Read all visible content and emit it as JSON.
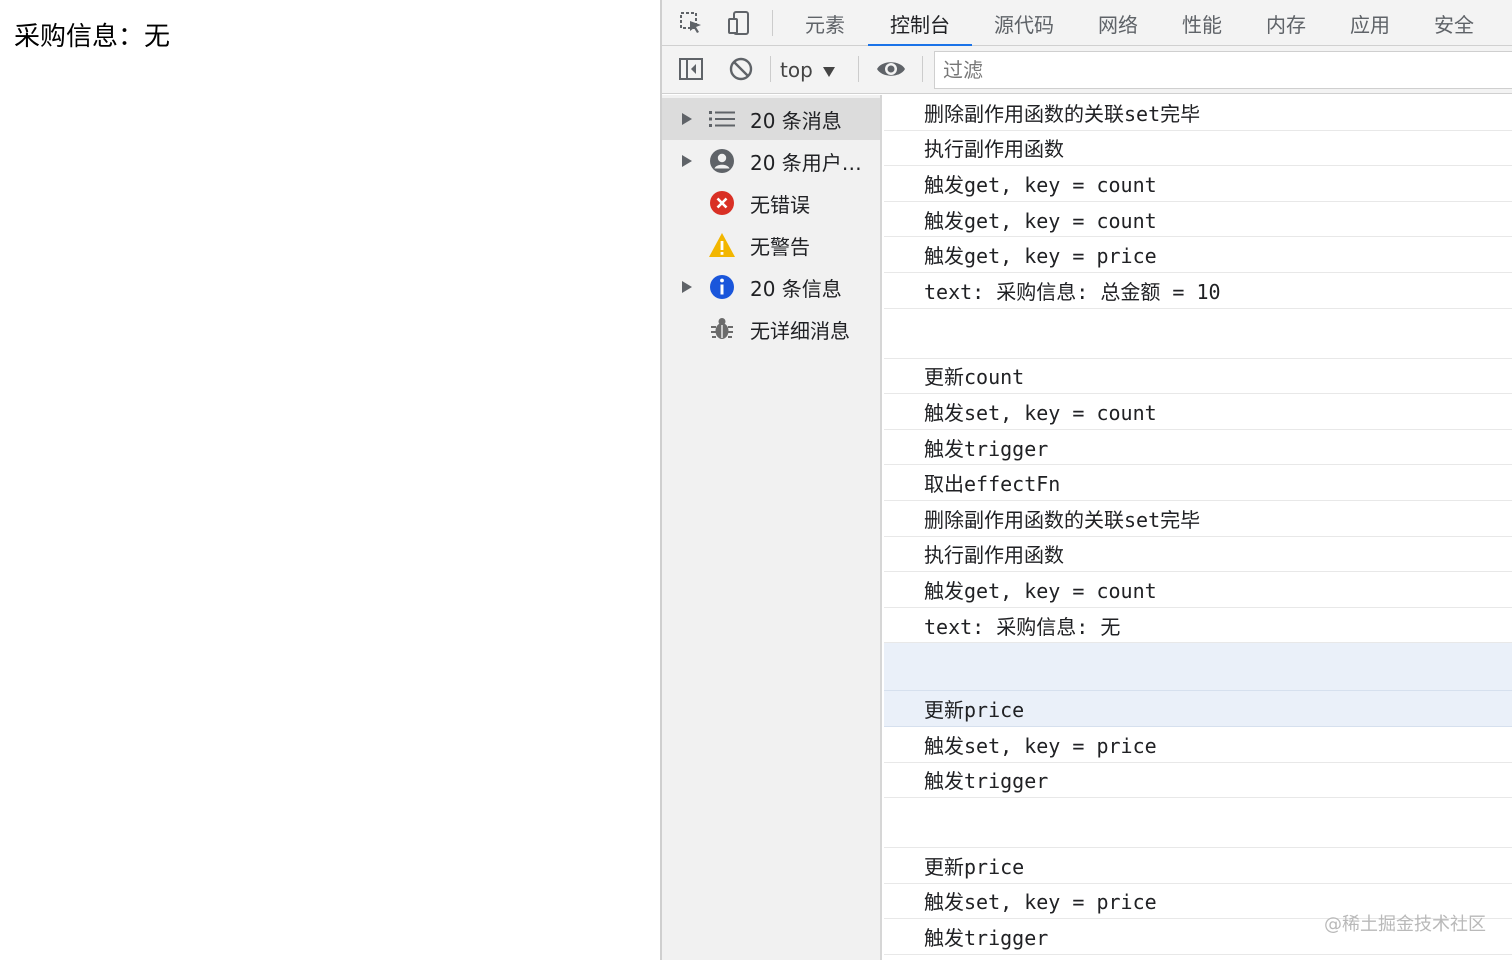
{
  "page": {
    "text": "采购信息：无"
  },
  "devtools": {
    "tabs": [
      {
        "label": "元素"
      },
      {
        "label": "控制台",
        "active": true
      },
      {
        "label": "源代码"
      },
      {
        "label": "网络"
      },
      {
        "label": "性能"
      },
      {
        "label": "内存"
      },
      {
        "label": "应用"
      },
      {
        "label": "安全"
      }
    ],
    "toolbar": {
      "context": "top",
      "filter_placeholder": "过滤"
    },
    "sidebar": {
      "items": [
        {
          "label": "20 条消息",
          "icon": "list-icon",
          "expandable": true,
          "selected": true
        },
        {
          "label": "20 条用户…",
          "icon": "user-icon",
          "expandable": true
        },
        {
          "label": "无错误",
          "icon": "error-icon",
          "expandable": false
        },
        {
          "label": "无警告",
          "icon": "warning-icon",
          "expandable": false
        },
        {
          "label": "20 条信息",
          "icon": "info-icon",
          "expandable": true
        },
        {
          "label": "无详细消息",
          "icon": "bug-icon",
          "expandable": false
        }
      ]
    },
    "console_lines": [
      "删除副作用函数的关联set完毕",
      "执行副作用函数",
      "触发get, key = count",
      "触发get, key = count",
      "触发get, key = price",
      "text: 采购信息: 总金额 = 10",
      "",
      "更新count",
      "触发set, key = count",
      "触发trigger",
      "取出effectFn",
      "删除副作用函数的关联set完毕",
      "执行副作用函数",
      "触发get, key = count",
      "text: 采购信息: 无",
      "",
      "更新price",
      "触发set, key = price",
      "触发trigger",
      "",
      "更新price",
      "触发set, key = price",
      "触发trigger"
    ],
    "colors": {
      "accent": "#1a73e8",
      "error": "#d93025",
      "warning": "#f2b600",
      "info": "#1a56db"
    }
  },
  "watermark": "@稀土掘金技术社区"
}
